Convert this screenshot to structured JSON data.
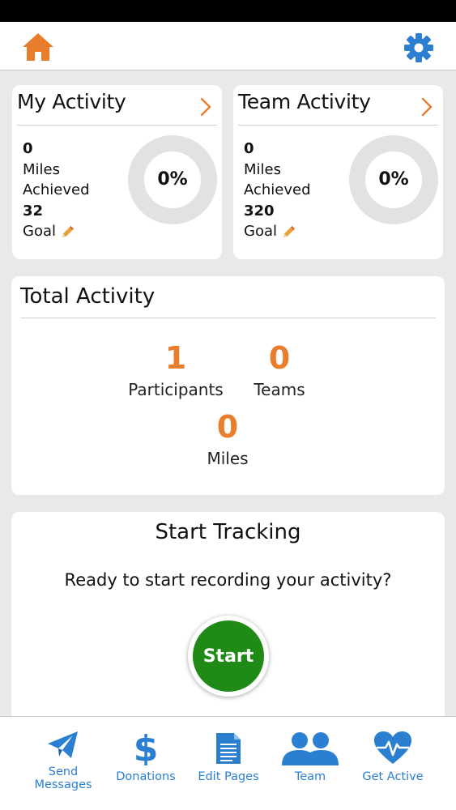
{
  "colors": {
    "accent": "#e87d2c",
    "nav_blue": "#2a7fd0",
    "start_green": "#1f8a15",
    "ring_gray": "#e2e2e4"
  },
  "header": {
    "home_icon": "home-icon",
    "settings_icon": "gear-icon"
  },
  "my_activity": {
    "title": "My Activity",
    "miles_value": "0",
    "miles_label": "Miles",
    "achieved_label": "Achieved",
    "goal_value": "32",
    "goal_label": "Goal",
    "percent": "0%",
    "progress": 0
  },
  "team_activity": {
    "title": "Team Activity",
    "miles_value": "0",
    "miles_label": "Miles",
    "achieved_label": "Achieved",
    "goal_value": "320",
    "goal_label": "Goal",
    "percent": "0%",
    "progress": 0
  },
  "total_activity": {
    "title": "Total Activity",
    "participants_value": "1",
    "participants_label": "Participants",
    "teams_value": "0",
    "teams_label": "Teams",
    "miles_value": "0",
    "miles_label": "Miles"
  },
  "start_tracking": {
    "title": "Start Tracking",
    "prompt": "Ready to start recording your activity?",
    "button_label": "Start"
  },
  "bottom_nav": {
    "send_messages_line1": "Send",
    "send_messages_line2": "Messages",
    "donations": "Donations",
    "edit_pages": "Edit Pages",
    "team": "Team",
    "get_active": "Get Active"
  }
}
